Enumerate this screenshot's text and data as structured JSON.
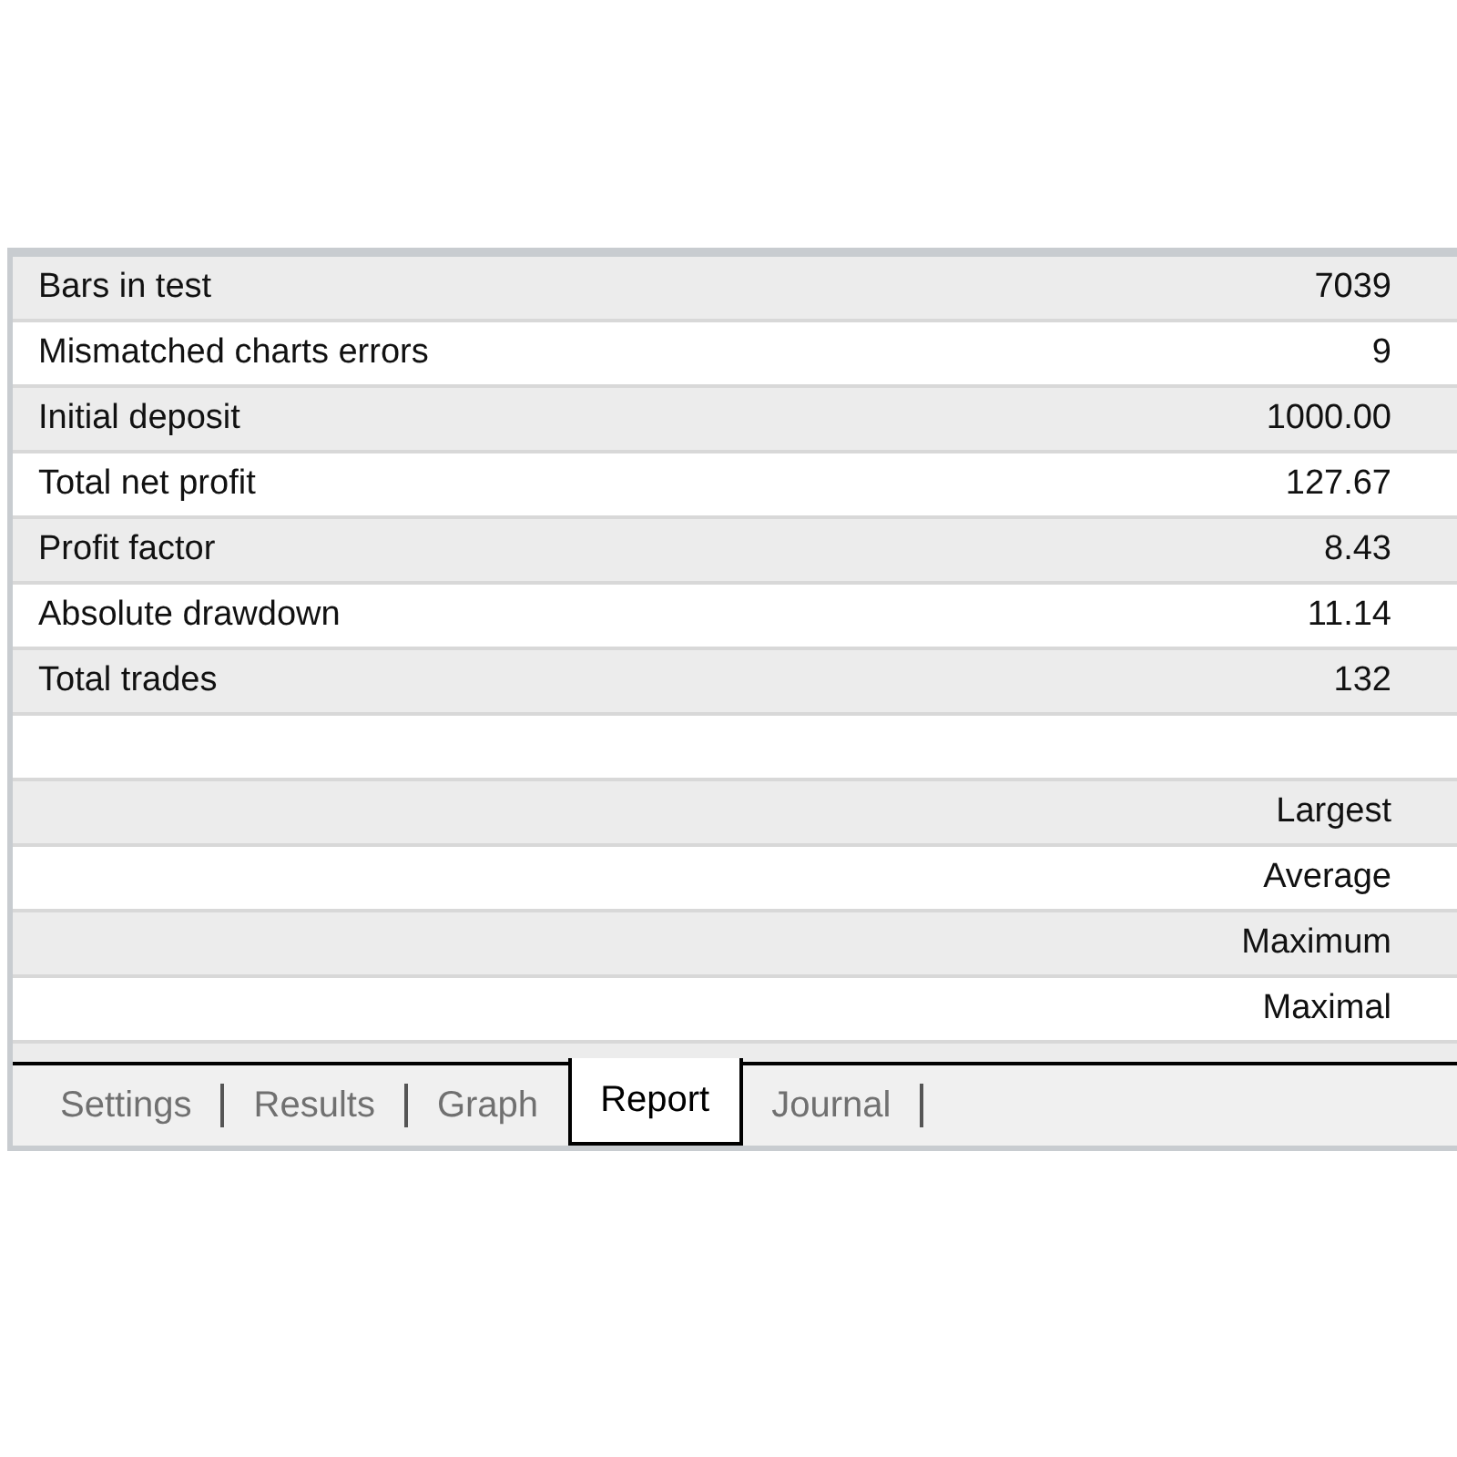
{
  "report": {
    "rows": [
      {
        "label": "Bars in test",
        "value": "7039"
      },
      {
        "label": "Mismatched charts errors",
        "value": "9"
      },
      {
        "label": "Initial deposit",
        "value": "1000.00"
      },
      {
        "label": "Total net profit",
        "value": "127.67"
      },
      {
        "label": "Profit factor",
        "value": "8.43"
      },
      {
        "label": "Absolute drawdown",
        "value": "11.14"
      },
      {
        "label": "Total trades",
        "value": "132"
      },
      {},
      {
        "value": "Largest"
      },
      {
        "value": "Average"
      },
      {
        "value": "Maximum"
      },
      {
        "value": "Maximal"
      }
    ]
  },
  "tabs": [
    {
      "label": "Settings",
      "selected": false
    },
    {
      "label": "Results",
      "selected": false
    },
    {
      "label": "Graph",
      "selected": false
    },
    {
      "label": "Report",
      "selected": true
    },
    {
      "label": "Journal",
      "selected": false
    }
  ]
}
